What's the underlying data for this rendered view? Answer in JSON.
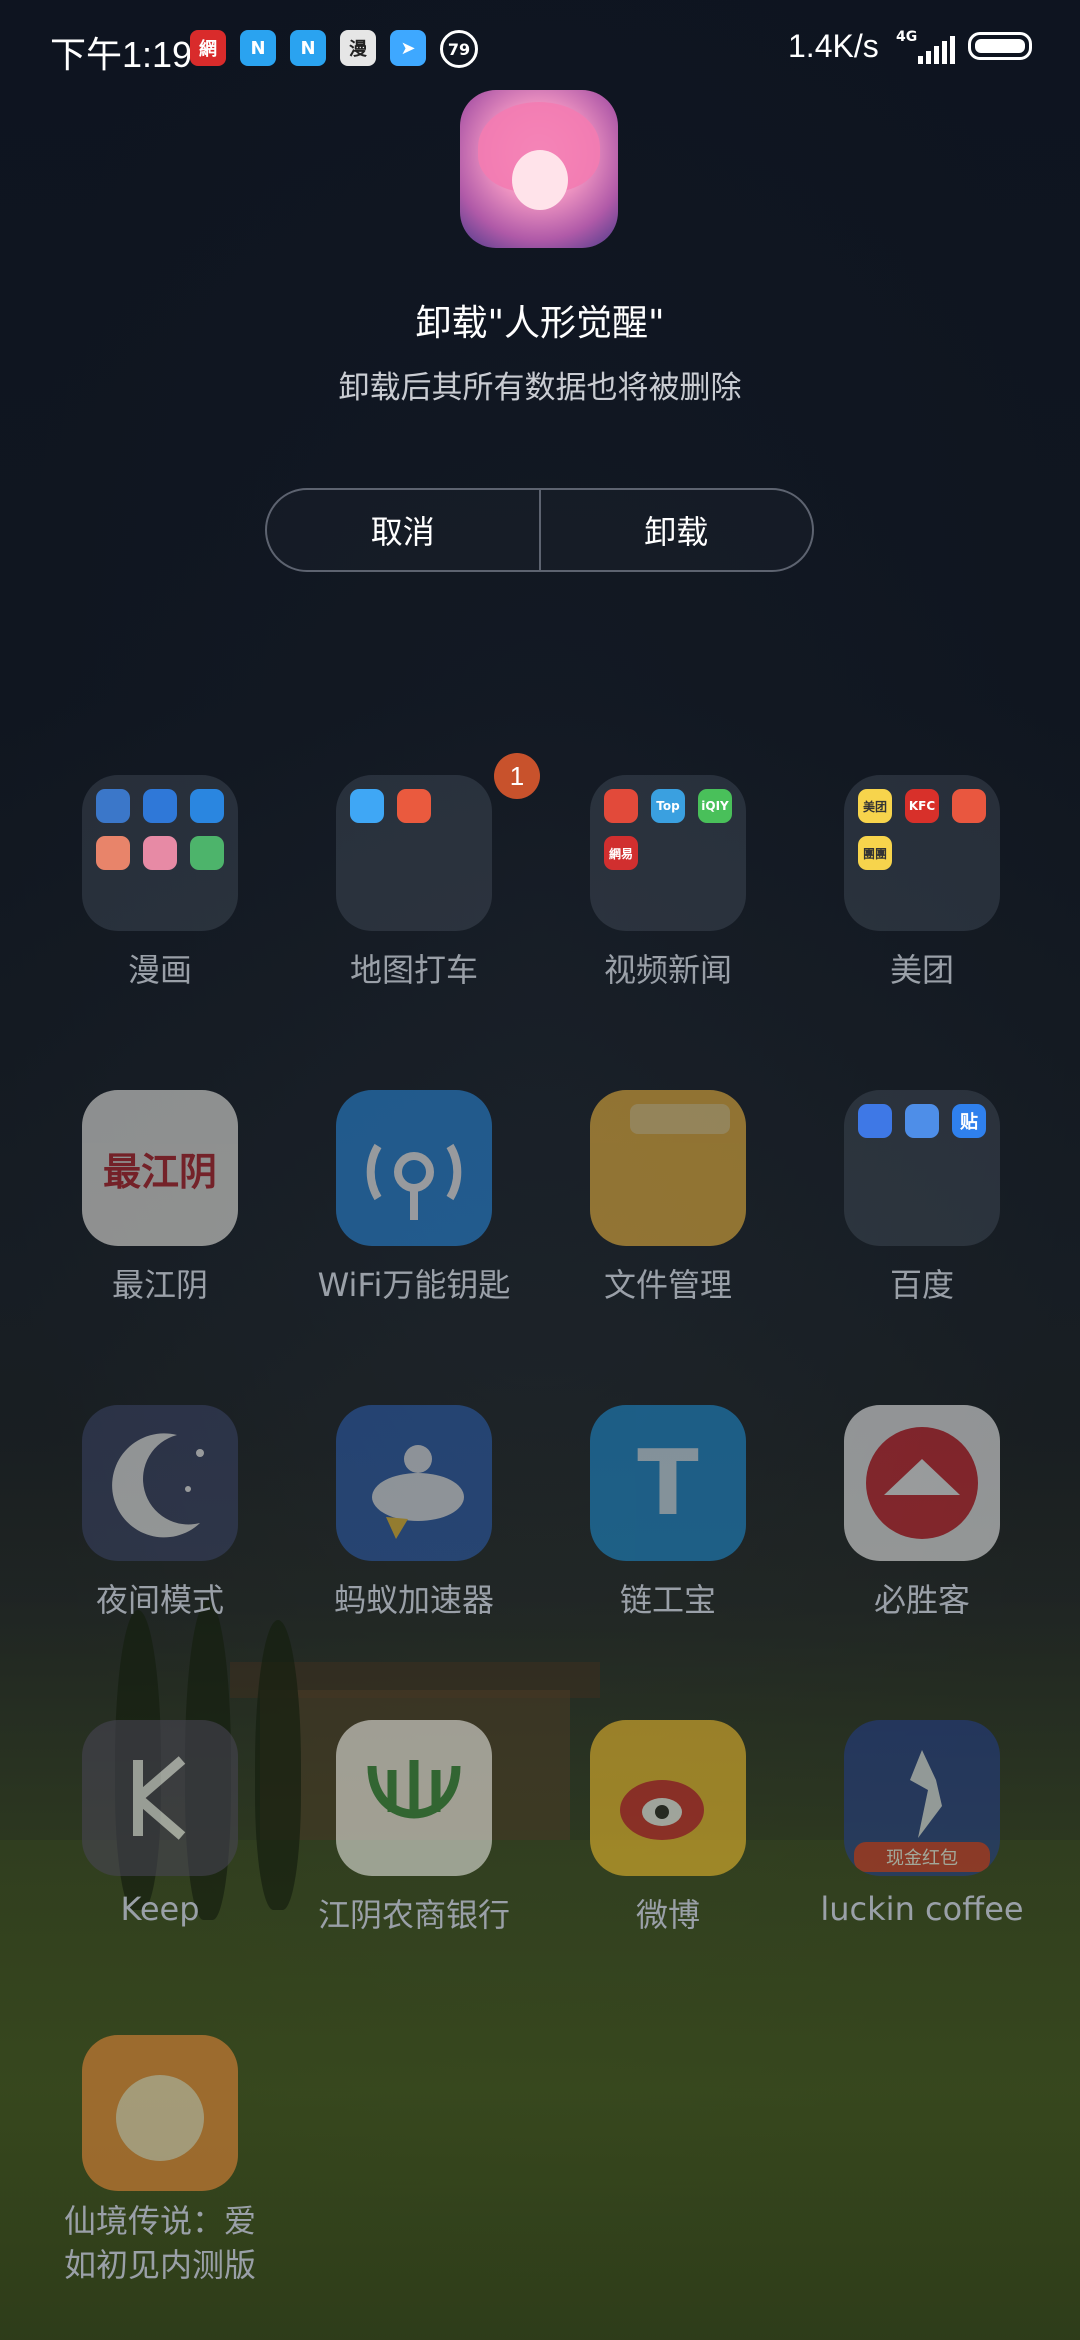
{
  "status_bar": {
    "time": "下午1:19",
    "notif_icons": [
      "netease-news-icon",
      "n-app-icon",
      "n-app-icon",
      "comic-app-icon",
      "telegram-like-icon",
      "notification-count-79"
    ],
    "notif_count": "79",
    "network_speed": "1.4K/s",
    "signal_label": "4G",
    "battery_icon": "battery-full-icon"
  },
  "dialog": {
    "app_icon": "anime-girl-app-icon",
    "title": "卸载\"人形觉醒\"",
    "subtitle": "卸载后其所有数据也将被删除",
    "cancel_label": "取消",
    "uninstall_label": "卸载"
  },
  "icons_grid": [
    {
      "label": "漫画",
      "type": "folder",
      "icon": "comics-folder-icon"
    },
    {
      "label": "地图打车",
      "type": "folder",
      "icon": "maps-taxi-folder-icon",
      "badge": "1"
    },
    {
      "label": "视频新闻",
      "type": "folder",
      "icon": "video-news-folder-icon"
    },
    {
      "label": "美团",
      "type": "folder",
      "icon": "meituan-folder-icon"
    },
    {
      "label": "最江阴",
      "type": "app",
      "icon": "zuijiangyin-icon",
      "tile_text": "最江阴"
    },
    {
      "label": "WiFi万能钥匙",
      "type": "app",
      "icon": "wifi-key-icon"
    },
    {
      "label": "文件管理",
      "type": "app",
      "icon": "file-manager-icon"
    },
    {
      "label": "百度",
      "type": "folder",
      "icon": "baidu-folder-icon",
      "mini_text": "贴"
    },
    {
      "label": "夜间模式",
      "type": "app",
      "icon": "night-mode-moon-icon"
    },
    {
      "label": "蚂蚁加速器",
      "type": "app",
      "icon": "ant-accelerator-rocket-icon"
    },
    {
      "label": "链工宝",
      "type": "app",
      "icon": "liangongbao-icon"
    },
    {
      "label": "必胜客",
      "type": "app",
      "icon": "pizza-hut-icon"
    },
    {
      "label": "Keep",
      "type": "app",
      "icon": "keep-icon"
    },
    {
      "label": "江阴农商银行",
      "type": "app",
      "icon": "jiangyin-bank-icon"
    },
    {
      "label": "微博",
      "type": "app",
      "icon": "weibo-icon"
    },
    {
      "label": "luckin coffee",
      "type": "app",
      "icon": "luckin-deer-icon",
      "tile_text": "现金红包"
    },
    {
      "label": "仙境传说：爱如初见内测版",
      "type": "app",
      "icon": "ragnarok-game-icon"
    }
  ],
  "last_label_lines": [
    "仙境传说：爱",
    "如初见内测版"
  ],
  "folder_minis": {
    "comics": [
      "#3b77c9",
      "#2f78d8",
      "#2a86e0",
      "#e8846a",
      "#e78aa5",
      "#4db46b"
    ],
    "maps": [
      "#3fa7f5",
      "#ea5a3e"
    ],
    "video": [
      "#e24a3a",
      "#3aa0e0",
      "#49c05a",
      "#d12f2f"
    ],
    "video_texts": [
      "",
      "Top",
      "iQIY",
      "網易"
    ],
    "meituan": [
      "#f7d44c",
      "#d8302a",
      "#e9573f",
      "#f7d44c"
    ],
    "meituan_texts": [
      "美团",
      "KFC",
      "",
      "團團"
    ],
    "baidu": [
      "#3e78e6",
      "#4e8ee8",
      "#2f80ed"
    ]
  }
}
